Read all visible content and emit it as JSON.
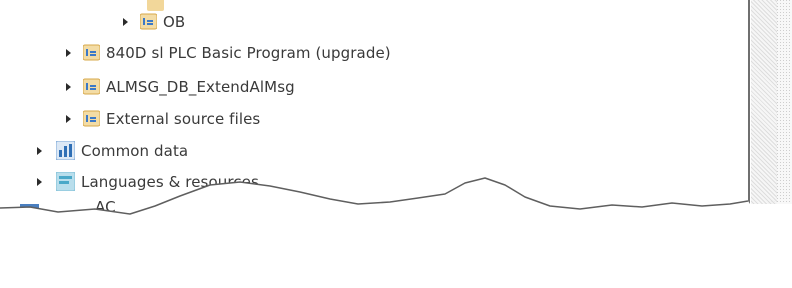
{
  "project_tree": {
    "items": [
      {
        "label": "",
        "icon": "program-block-folder-icon",
        "expanded": false
      },
      {
        "label": "OB",
        "icon": "program-block-folder-icon",
        "expanded": false
      },
      {
        "label": "840D sl PLC Basic Program (upgrade)",
        "icon": "program-block-folder-icon",
        "expanded": false
      },
      {
        "label": "ALMSG_DB_ExtendAlMsg",
        "icon": "program-block-folder-icon",
        "expanded": false
      },
      {
        "label": "External source files",
        "icon": "program-block-folder-icon",
        "expanded": false
      },
      {
        "label": "Common data",
        "icon": "common-data-icon",
        "expanded": false
      },
      {
        "label": "Languages & resources",
        "icon": "languages-icon",
        "expanded": false
      },
      {
        "label": "AC",
        "icon": "device-icon",
        "expanded": false
      }
    ]
  },
  "colors": {
    "folder_orange": "#e9b44c",
    "folder_blue": "#3c79c7",
    "common_data_blue": "#2f6fb5",
    "languages_teal": "#4aa8c8",
    "text": "#3a3a3a",
    "arrow": "#2b2b2b",
    "torn_edge": "#6f6f6f"
  }
}
